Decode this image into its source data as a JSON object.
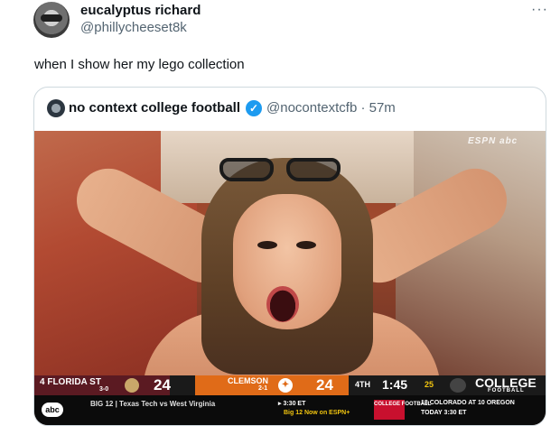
{
  "tweet": {
    "display_name": "eucalyptus richard",
    "handle": "@phillycheeset8k",
    "more_label": "···",
    "text": "when I show her my lego collection"
  },
  "quoted": {
    "display_name": "no context college football",
    "verified_label": "✓",
    "handle_time": "@nocontextcfb · 57m"
  },
  "media": {
    "network_bug": "ESPN abc",
    "scoreboard": {
      "team1_name": "4 FLORIDA ST",
      "team1_record": "3-0",
      "team1_score": "24",
      "team2_name": "CLEMSON",
      "team2_record": "2-1",
      "team2_score": "24",
      "quarter": "4TH",
      "clock": "1:45",
      "play_clock": "25",
      "brand_main": "COLLEGE",
      "brand_sub": "FOOTBALL",
      "network": "abc",
      "ticker": "BIG 12 | Texas Tech vs West Virginia",
      "ticker_time": "▸ 3:30 ET",
      "ticker_net": "Big 12 Now on ESPN+",
      "badge": "COLLEGE FOOTBALL",
      "next_line1": "18 COLORADO AT 10 OREGON",
      "next_line2": "TODAY 3:30 ET"
    }
  }
}
